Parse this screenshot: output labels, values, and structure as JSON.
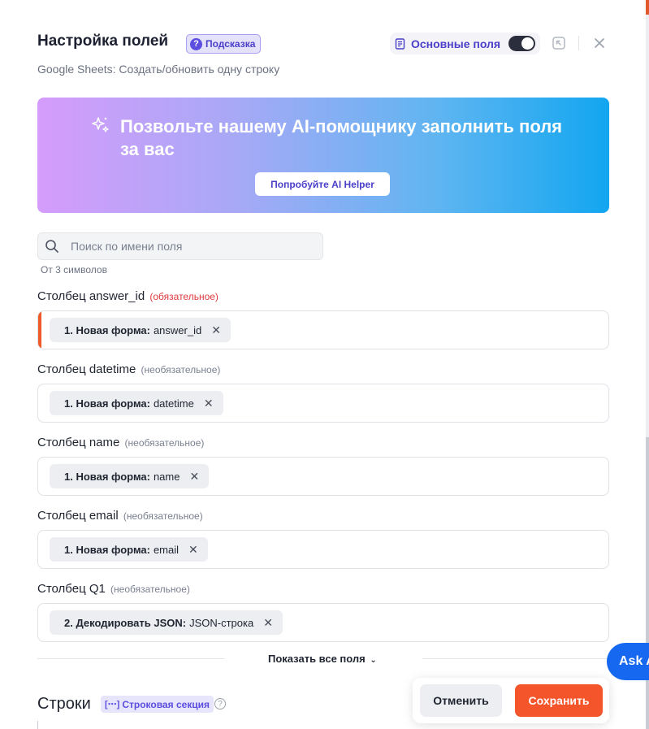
{
  "header": {
    "title": "Настройка полей",
    "hint_label": "Подсказка",
    "subtitle": "Google Sheets: Создать/обновить одну строку",
    "basic_fields_label": "Основные поля",
    "basic_fields_on": true
  },
  "ai_banner": {
    "headline": "Позвольте нашему AI-помощнику заполнить поля за вас",
    "button_label": "Попробуйте AI Helper"
  },
  "search": {
    "placeholder": "Поиск по имени поля",
    "value": "",
    "hint": "От 3 символов"
  },
  "fields": [
    {
      "label": "Столбец answer_id",
      "tag": "(обязательное)",
      "required": true,
      "source": "1. Новая форма:",
      "value": "answer_id"
    },
    {
      "label": "Столбец datetime",
      "tag": "(необязательное)",
      "required": false,
      "source": "1. Новая форма:",
      "value": "datetime"
    },
    {
      "label": "Столбец name",
      "tag": "(необязательное)",
      "required": false,
      "source": "1. Новая форма:",
      "value": "name"
    },
    {
      "label": "Столбец email",
      "tag": "(необязательное)",
      "required": false,
      "source": "1. Новая форма:",
      "value": "email"
    },
    {
      "label": "Столбец Q1",
      "tag": "(необязательное)",
      "required": false,
      "source": "2. Декодировать JSON:",
      "value": "JSON-строка"
    }
  ],
  "show_all": "Показать все поля",
  "rows_section": {
    "title": "Строки",
    "badge": "Строковая секция"
  },
  "footer": {
    "cancel_label": "Отменить",
    "save_label": "Сохранить"
  },
  "ask_ai_label": "Ask AI",
  "colors": {
    "accent": "#5b4ee0",
    "save": "#f4552b",
    "required_marker": "#ef5a2a",
    "ask_ai": "#1668f0"
  },
  "icons": [
    "help-icon",
    "document-list-icon",
    "collapse-panel-icon",
    "close-icon",
    "sparkle-icon",
    "search-icon",
    "remove-chip-icon",
    "chevron-down-icon",
    "row-section-icon"
  ]
}
